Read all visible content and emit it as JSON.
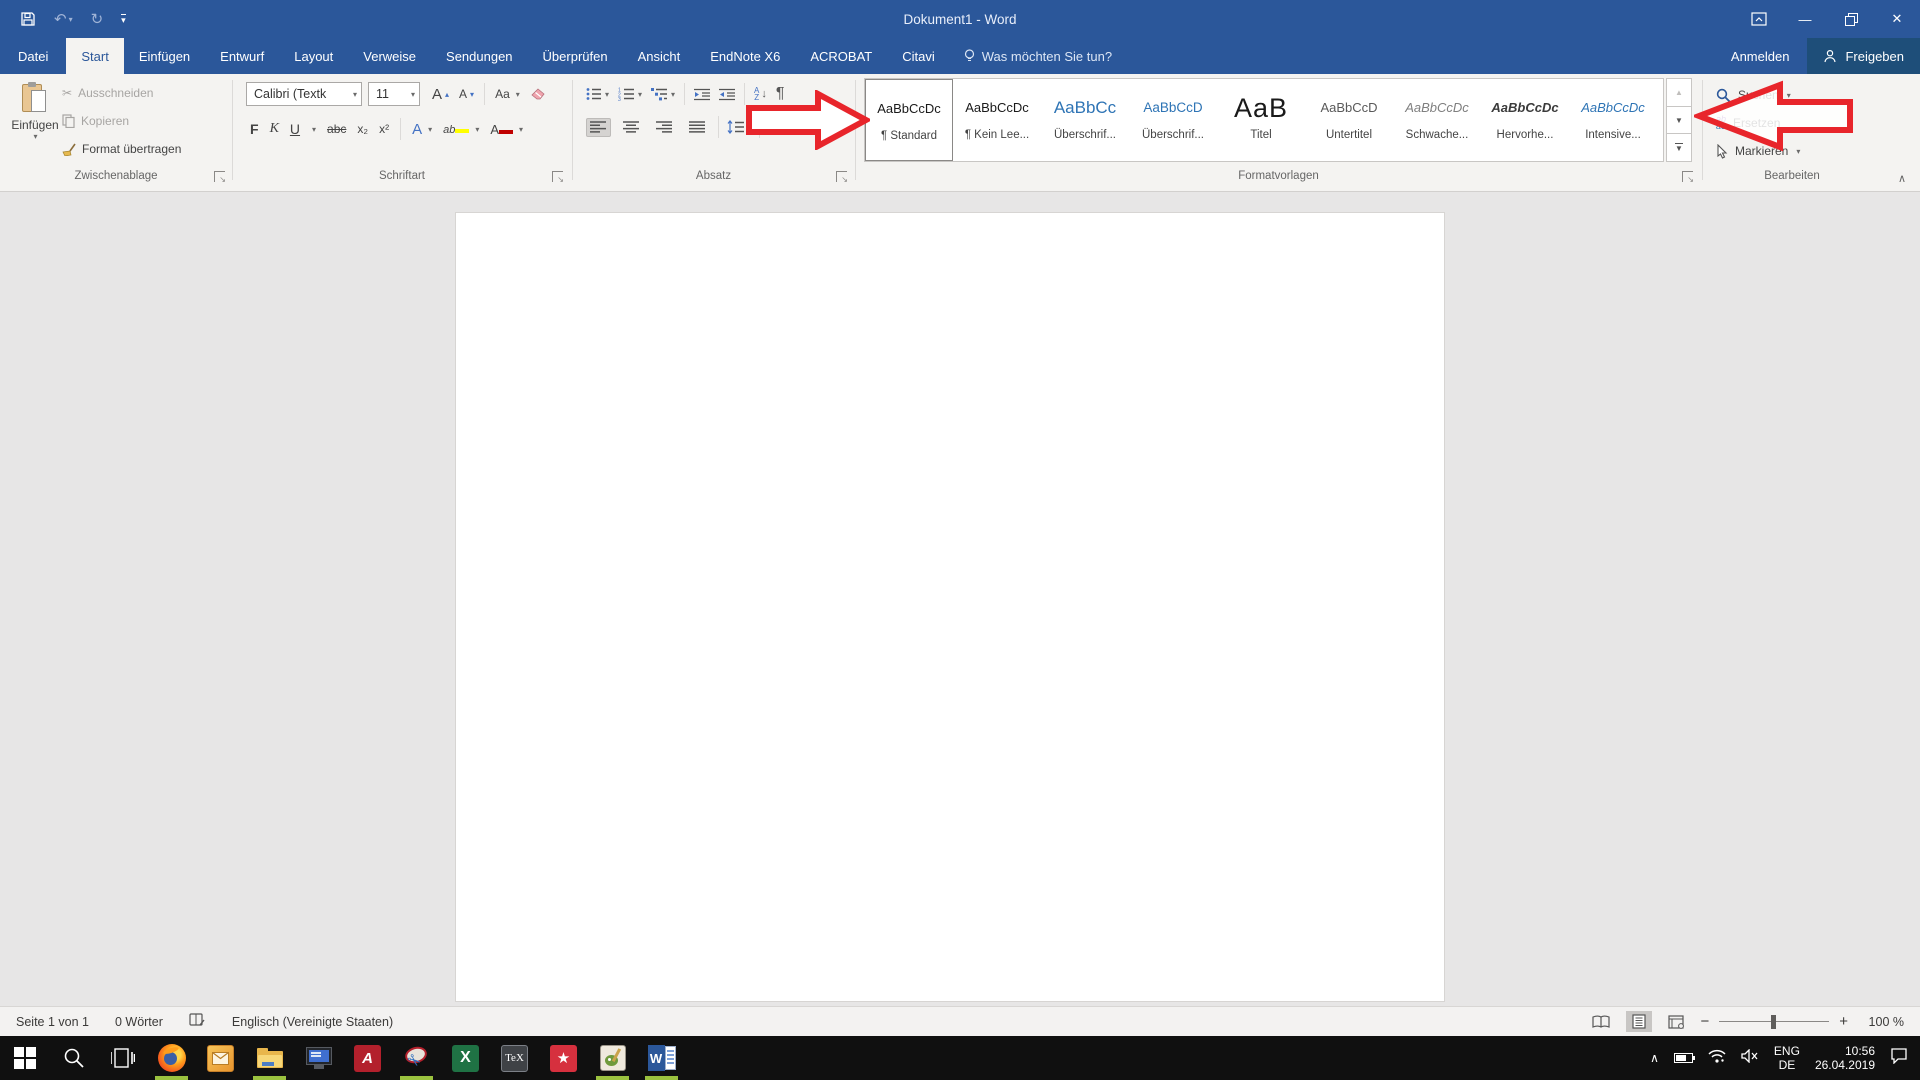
{
  "colors": {
    "titlebar_blue": "#2b579a",
    "share_button_blue": "#1e4e79",
    "heading_blue": "#2e74b5",
    "annotation_red": "#e8252b",
    "running_indicator_green": "#9bc23f",
    "highlight_yellow": "#ffff00",
    "font_color_red": "#c00000"
  },
  "titlebar": {
    "title": "Dokument1 - Word"
  },
  "account": {
    "signin_label": "Anmelden",
    "share_label": "Freigeben"
  },
  "tabs": {
    "file": "Datei",
    "active": "Start",
    "items": [
      "Start",
      "Einfügen",
      "Entwurf",
      "Layout",
      "Verweise",
      "Sendungen",
      "Überprüfen",
      "Ansicht",
      "EndNote X6",
      "ACROBAT",
      "Citavi"
    ],
    "tell_me": "Was möchten Sie tun?"
  },
  "clipboard_group": {
    "label": "Zwischenablage",
    "paste_label": "Einfügen",
    "cut_label": "Ausschneiden",
    "copy_label": "Kopieren",
    "format_painter_label": "Format übertragen"
  },
  "font_group": {
    "label": "Schriftart",
    "font_name": "Calibri (Textk",
    "font_size": "11",
    "bold_label": "F",
    "italic_label": "K",
    "underline_label": "U",
    "strikethrough_label": "abc",
    "subscript_label": "x₂",
    "superscript_label": "x²",
    "change_case_label": "Aa",
    "text_effects_label": "A",
    "highlight_label": "ab",
    "font_color_label": "A"
  },
  "paragraph_group": {
    "label": "Absatz",
    "sort_top": "A",
    "sort_bottom": "Z",
    "pilcrow": "¶"
  },
  "styles_group": {
    "label": "Formatvorlagen",
    "items": [
      {
        "sample": "AaBbCcDc",
        "name": "¶ Standard"
      },
      {
        "sample": "AaBbCcDc",
        "name": "¶ Kein Lee..."
      },
      {
        "sample": "AaBbCc",
        "name": "Überschrif..."
      },
      {
        "sample": "AaBbCcD",
        "name": "Überschrif..."
      },
      {
        "sample": "AaB",
        "name": "Titel"
      },
      {
        "sample": "AaBbCcD",
        "name": "Untertitel"
      },
      {
        "sample": "AaBbCcDc",
        "name": "Schwache..."
      },
      {
        "sample": "AaBbCcDc",
        "name": "Hervorhe..."
      },
      {
        "sample": "AaBbCcDc",
        "name": "Intensive..."
      }
    ]
  },
  "editing_group": {
    "label": "Bearbeiten",
    "find_label": "Suchen",
    "replace_label": "Ersetzen",
    "replace_icon_top": "ab",
    "replace_icon_bottom": "ac",
    "select_label": "Markieren"
  },
  "statusbar": {
    "page_info": "Seite 1 von 1",
    "word_count": "0 Wörter",
    "language": "Englisch (Vereinigte Staaten)",
    "zoom_level": "100 %"
  },
  "tray": {
    "language_primary": "ENG",
    "language_secondary": "DE",
    "time": "10:56",
    "date": "26.04.2019"
  }
}
